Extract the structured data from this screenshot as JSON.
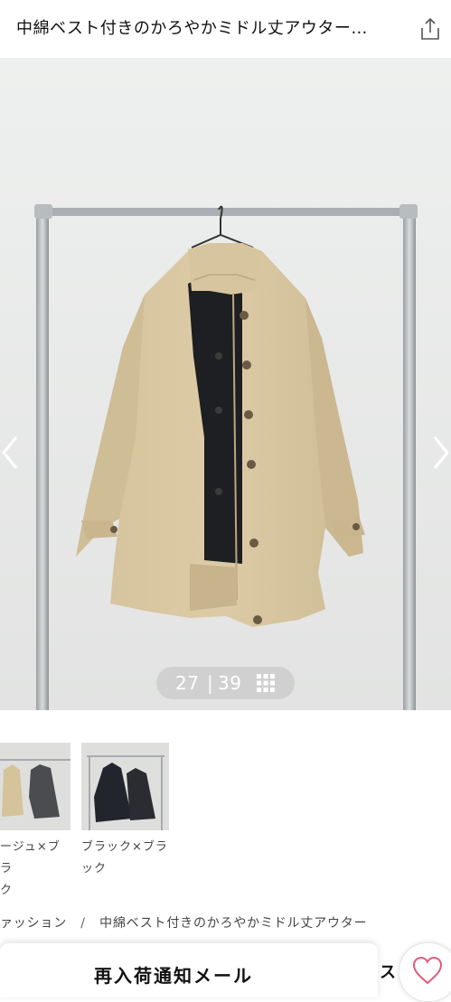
{
  "header": {
    "title": "中綿ベスト付きのかろやかミドル丈アウター…",
    "share_icon": "share-icon"
  },
  "gallery": {
    "current": "27",
    "separator": "|",
    "total": "39",
    "grid_icon": "grid-icon",
    "prev_icon": "chevron-left-icon",
    "next_icon": "chevron-right-icon"
  },
  "variants": [
    {
      "label_line1": "ージュ×ブラ",
      "label_line2": "ク"
    },
    {
      "label_line1": "ブラック×ブラ",
      "label_line2": "ック"
    }
  ],
  "breadcrumb": {
    "items": [
      "ァッション",
      "中綿ベスト付きのかろやかミドル丈アウター"
    ],
    "separator": "/"
  },
  "restock": {
    "label": "再入荷通知メール",
    "trailing": "ス"
  },
  "favorite": {
    "icon": "heart-icon"
  },
  "colors": {
    "accent": "#e05a78",
    "coat": "#d8c6a0",
    "background": "#e7e8e7"
  }
}
